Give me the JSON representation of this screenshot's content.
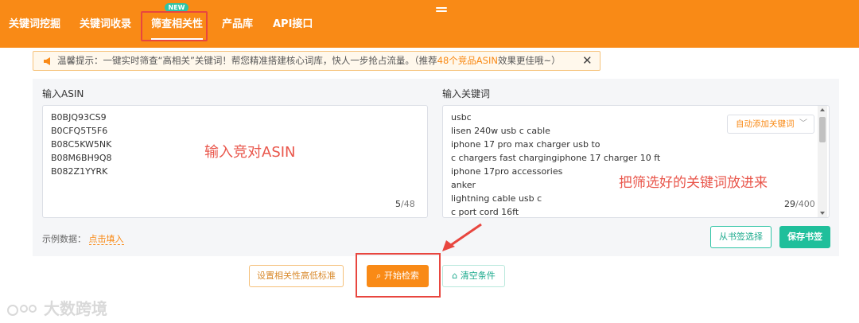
{
  "nav": {
    "items": [
      {
        "label": "关键词挖掘"
      },
      {
        "label": "关键词收录"
      },
      {
        "label": "筛查相关性",
        "badge": "NEW"
      },
      {
        "label": "产品库"
      },
      {
        "label": "API接口"
      }
    ]
  },
  "notice": {
    "prefix": "温馨提示：一键实时筛查“高相关”关键词！帮您精准搭建核心词库，快人一步抢占流量。（推荐",
    "highlight": "48个竞品ASIN",
    "suffix": "效果更佳哦~）",
    "close": "✕"
  },
  "asin_box": {
    "label": "输入ASIN",
    "values": [
      "B0BJQ93CS9",
      "B0CFQ5T5F6",
      "B08C5KW5NK",
      "B08M6BH9Q8",
      "B082Z1YYRK"
    ],
    "count": "5",
    "max": "/48",
    "annotation": "输入竞对ASIN"
  },
  "keyword_box": {
    "label": "输入关键词",
    "values": [
      "usbc",
      "lisen 240w usb c cable",
      "iphone 17 pro max charger usb to",
      "c chargers fast chargingiphone 17 charger 10 ft",
      "iphone 17pro accessories",
      "anker",
      "lightning cable usb c",
      "c port cord 16ft"
    ],
    "dropdown": "自动添加关键词",
    "count": "29",
    "max": "/400",
    "annotation": "把筛选好的关键词放进来"
  },
  "example": {
    "label": "示例数据：",
    "link": "点击填入"
  },
  "buttons": {
    "bookmark": "从书签选择",
    "save": "保存书签",
    "threshold": "设置相关性高低标准",
    "search": "开始检索",
    "clear": "清空条件"
  },
  "watermark": "大数跨境",
  "colors": {
    "brand_orange": "#f98a16",
    "teal": "#1fbf9b",
    "annotation_red": "#e8463f"
  }
}
